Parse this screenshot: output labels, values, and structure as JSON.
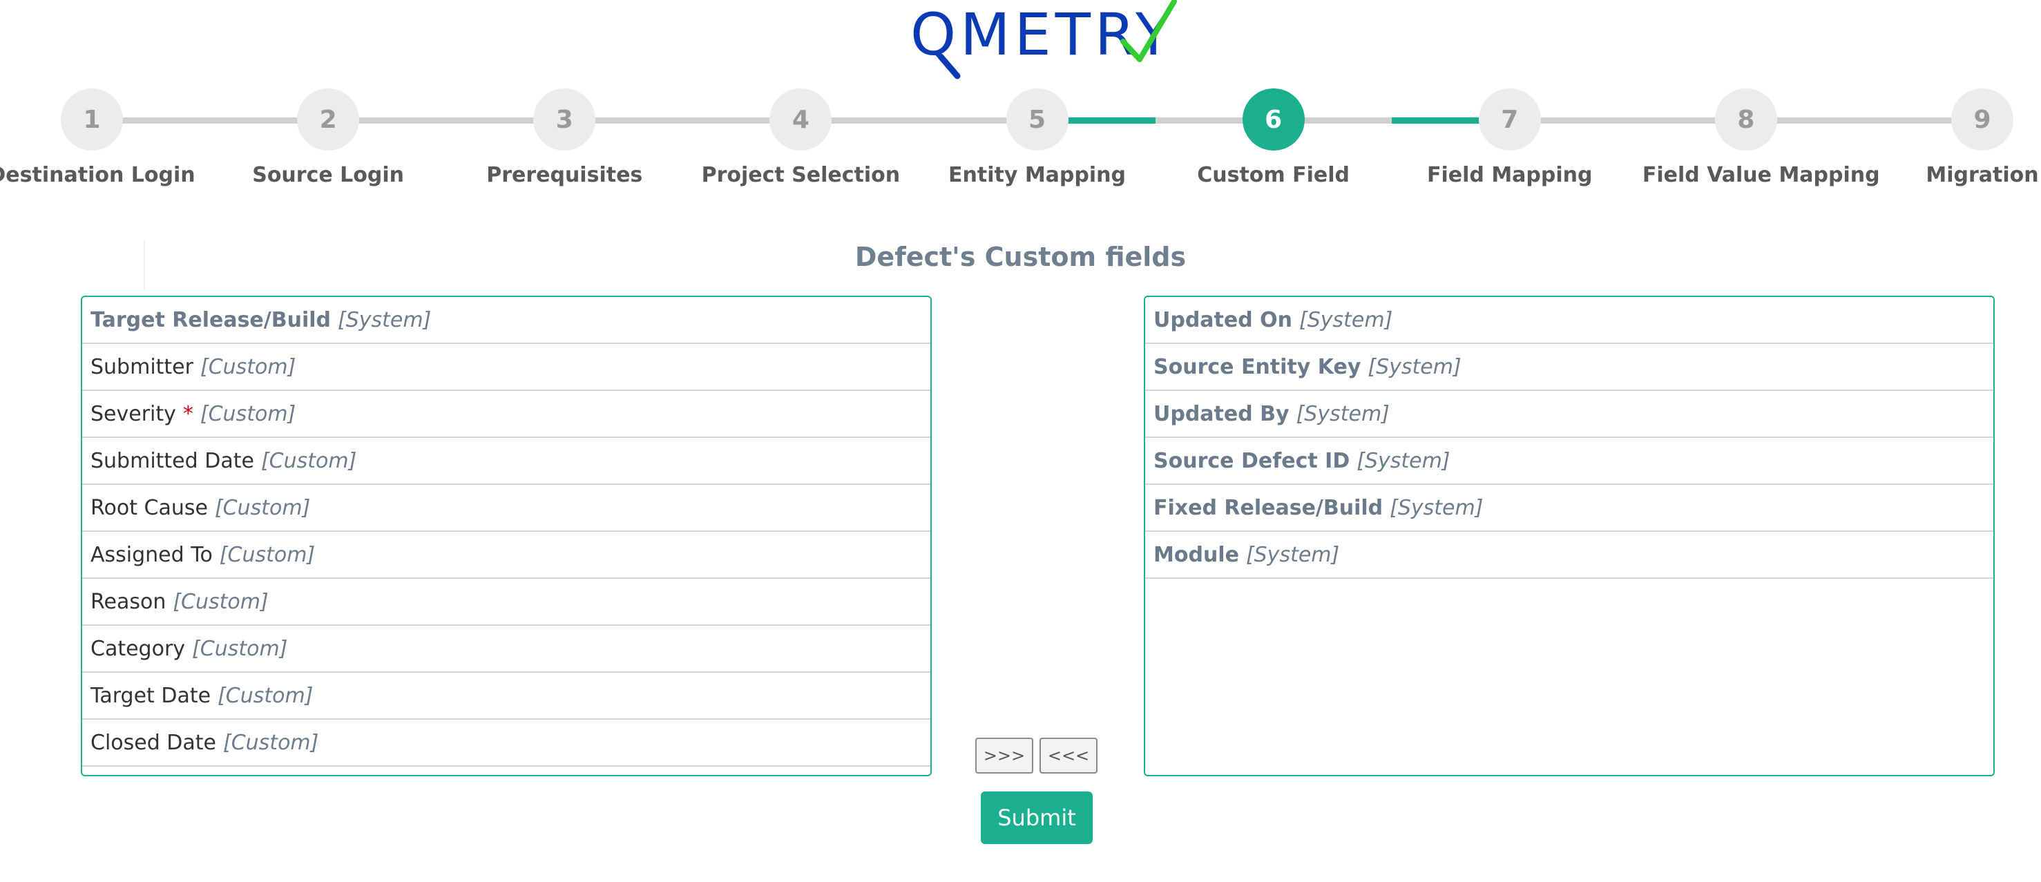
{
  "header": {
    "logo_text": "QMETRY",
    "logo_icon": "magnifier-check-logo",
    "brand_colors": {
      "primary": "#0a3ab4",
      "check": "#33cc33"
    }
  },
  "stepper": {
    "active_index": 5,
    "accent_color": "#1aaf8e",
    "steps": [
      {
        "number": "1",
        "label": "Destination Login"
      },
      {
        "number": "2",
        "label": "Source Login"
      },
      {
        "number": "3",
        "label": "Prerequisites"
      },
      {
        "number": "4",
        "label": "Project Selection"
      },
      {
        "number": "5",
        "label": "Entity Mapping"
      },
      {
        "number": "6",
        "label": "Custom Field"
      },
      {
        "number": "7",
        "label": "Field Mapping"
      },
      {
        "number": "8",
        "label": "Field Value Mapping"
      },
      {
        "number": "9",
        "label": "Migration"
      }
    ]
  },
  "main": {
    "title": "Defect's Custom fields",
    "left_list": [
      {
        "name": "Target Release/Build",
        "type": "[System]",
        "system": true,
        "required": false
      },
      {
        "name": "Submitter",
        "type": "[Custom]",
        "system": false,
        "required": false
      },
      {
        "name": "Severity",
        "type": "[Custom]",
        "system": false,
        "required": true
      },
      {
        "name": "Submitted Date",
        "type": "[Custom]",
        "system": false,
        "required": false
      },
      {
        "name": "Root Cause",
        "type": "[Custom]",
        "system": false,
        "required": false
      },
      {
        "name": "Assigned To",
        "type": "[Custom]",
        "system": false,
        "required": false
      },
      {
        "name": "Reason",
        "type": "[Custom]",
        "system": false,
        "required": false
      },
      {
        "name": "Category",
        "type": "[Custom]",
        "system": false,
        "required": false
      },
      {
        "name": "Target Date",
        "type": "[Custom]",
        "system": false,
        "required": false
      },
      {
        "name": "Closed Date",
        "type": "[Custom]",
        "system": false,
        "required": false
      }
    ],
    "right_list": [
      {
        "name": "Updated On",
        "type": "[System]",
        "system": true,
        "required": false
      },
      {
        "name": "Source Entity Key",
        "type": "[System]",
        "system": true,
        "required": false
      },
      {
        "name": "Updated By",
        "type": "[System]",
        "system": true,
        "required": false
      },
      {
        "name": "Source Defect ID",
        "type": "[System]",
        "system": true,
        "required": false
      },
      {
        "name": "Fixed Release/Build",
        "type": "[System]",
        "system": true,
        "required": false
      },
      {
        "name": "Module",
        "type": "[System]",
        "system": true,
        "required": false
      }
    ],
    "required_marker": "*",
    "move_right_label": ">>>",
    "move_left_label": "<<<",
    "submit_label": "Submit"
  }
}
